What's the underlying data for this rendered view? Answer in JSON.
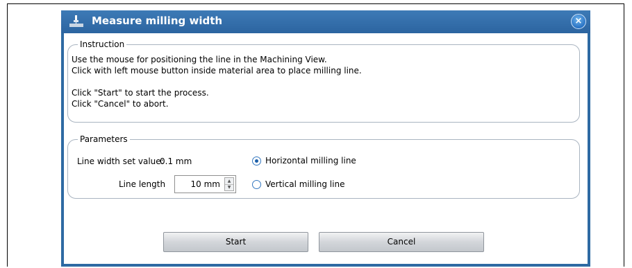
{
  "dialog": {
    "title": "Measure milling width",
    "title_icon": "milling-tool-icon",
    "close_glyph": "×"
  },
  "instruction": {
    "group_title": "Instruction",
    "lines": [
      "Use the mouse for positioning the line in the Machining View.",
      "Click with left mouse button inside material area to place milling line.",
      "",
      "Click \"Start\" to start the process.",
      "Click \"Cancel\" to abort."
    ]
  },
  "parameters": {
    "group_title": "Parameters",
    "line_width_label": "Line width set value:",
    "line_width_value": "0.1 mm",
    "line_length_label": "Line length",
    "line_length_value": "10 mm",
    "orientation_options": [
      {
        "label": "Horizontal milling line",
        "checked": true
      },
      {
        "label": "Vertical milling line",
        "checked": false
      }
    ]
  },
  "buttons": {
    "start": "Start",
    "cancel": "Cancel"
  },
  "colors": {
    "title_bar": "#2e6aa3",
    "radio_accent": "#1d5fa8"
  }
}
